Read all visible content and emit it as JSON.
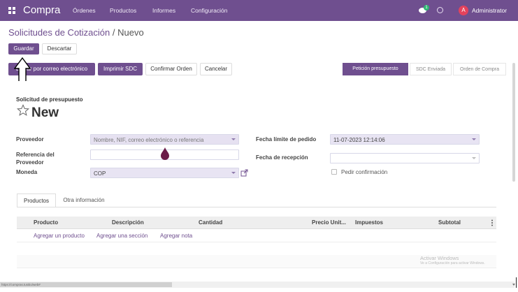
{
  "topbar": {
    "brand": "Compra",
    "menu": [
      "Órdenes",
      "Productos",
      "Informes",
      "Configuración"
    ],
    "notification_count": "1",
    "user_initial": "A",
    "user_name": "Administrator"
  },
  "breadcrumb": {
    "parent": "Solicitudes de Cotización",
    "separator": "/",
    "current": "Nuevo"
  },
  "control": {
    "save": "Guardar",
    "discard": "Descartar"
  },
  "actions": {
    "send_email": "Enviar por correo electrónico",
    "print": "Imprimir SDC",
    "confirm": "Confirmar Orden",
    "cancel": "Cancelar"
  },
  "status": {
    "steps": [
      "Petición presupuesto",
      "SDC Enviada",
      "Orden de Compra"
    ],
    "active_index": 0
  },
  "form": {
    "doc_type": "Solicitud de presupuesto",
    "title": "New",
    "fields": {
      "proveedor_label": "Proveedor",
      "proveedor_placeholder": "Nombre, NIF, correo electrónico o referencia",
      "referencia_label": "Referencia del Proveedor",
      "moneda_label": "Moneda",
      "moneda_value": "COP",
      "fecha_limite_label": "Fecha límite de pedido",
      "fecha_limite_value": "11-07-2023 12:14:06",
      "fecha_recepcion_label": "Fecha de recepción",
      "pedir_confirmacion_label": "Pedir confirmación"
    }
  },
  "tabs": [
    "Productos",
    "Otra información"
  ],
  "lines_table": {
    "columns": [
      "Producto",
      "Descripción",
      "Cantidad",
      "Precio Unit...",
      "Impuestos",
      "Subtotal"
    ],
    "add_links": [
      "Agregar un producto",
      "Agregar una sección",
      "Agregar nota"
    ]
  },
  "watermark": {
    "line1": "Activar Windows",
    "line2": "Ve a Configuración para activar Windows."
  },
  "status_url": "https://compras.tusitio/web#"
}
